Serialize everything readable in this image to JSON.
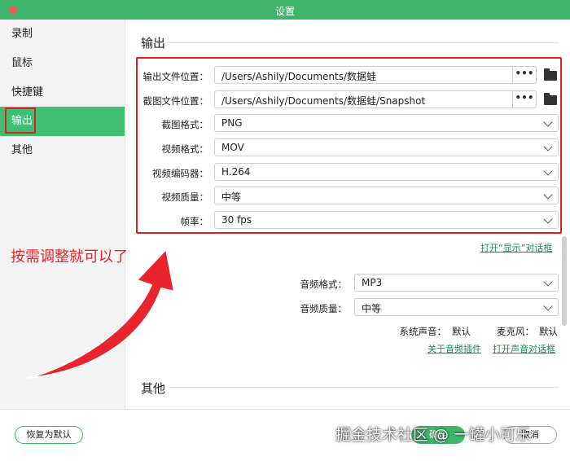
{
  "window": {
    "title": "设置"
  },
  "sidebar": {
    "items": [
      {
        "label": "录制"
      },
      {
        "label": "鼠标"
      },
      {
        "label": "快捷键"
      },
      {
        "label": "输出",
        "active": true
      },
      {
        "label": "其他"
      }
    ]
  },
  "output": {
    "heading": "输出",
    "output_location": {
      "label": "输出文件位置：",
      "value": "/Users/Ashily/Documents/数据蛙",
      "browse": "•••"
    },
    "snapshot_location": {
      "label": "截图文件位置：",
      "value": "/Users/Ashily/Documents/数据蛙/Snapshot",
      "browse": "•••"
    },
    "screenshot_format": {
      "label": "截图格式：",
      "value": "PNG"
    },
    "video_format": {
      "label": "视频格式：",
      "value": "MOV"
    },
    "video_encoder": {
      "label": "视频编码器：",
      "value": "H.264"
    },
    "video_quality": {
      "label": "视频质量：",
      "value": "中等"
    },
    "frame_rate": {
      "label": "帧率：",
      "value": "30 fps"
    },
    "open_display_link": "打开“显示”对话框"
  },
  "audio": {
    "audio_format": {
      "label": "音频格式：",
      "value": "MP3"
    },
    "audio_quality": {
      "label": "音频质量：",
      "value": "中等"
    },
    "system_sound": {
      "label": "系统声音：",
      "value": "默认"
    },
    "microphone": {
      "label": "麦克风：",
      "value": "默认"
    },
    "plugin_link": "关于音频插件",
    "open_sound_link": "打开声音对话框"
  },
  "other": {
    "heading": "其他"
  },
  "annotation": {
    "text": "按需调整就可以了"
  },
  "footer": {
    "reset": "恢复为默认",
    "ok": "确定",
    "cancel": "取消"
  },
  "watermark": {
    "text": "掘金技术社区 @ 一罐小可乐"
  },
  "colors": {
    "accent": "#3eb56a",
    "annotation": "#e8242c",
    "link": "#1d8a4a"
  }
}
